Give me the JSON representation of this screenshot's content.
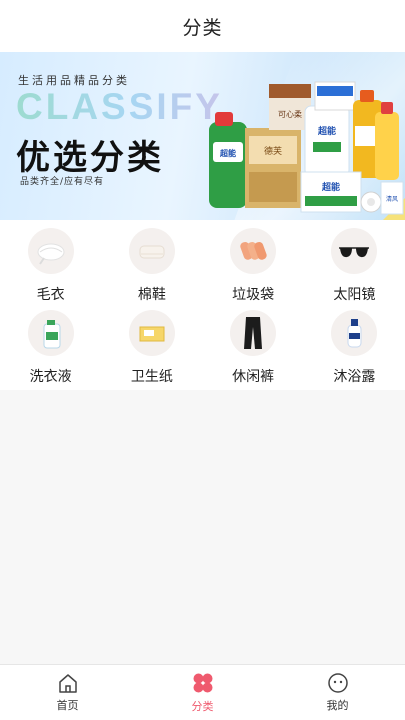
{
  "header": {
    "title": "分类"
  },
  "banner": {
    "tagline": "生活用品精品分类",
    "headline_en": "CLASSIFY",
    "headline_cn": "优选分类",
    "subline": "品类齐全/应有尽有",
    "products": [
      "超能",
      "德芙",
      "可心柔",
      "超能",
      "超能",
      "清风"
    ]
  },
  "categories": [
    {
      "label": "毛衣",
      "icon": "sweater-icon"
    },
    {
      "label": "棉鞋",
      "icon": "cotton-shoes-icon"
    },
    {
      "label": "垃圾袋",
      "icon": "trash-bag-icon"
    },
    {
      "label": "太阳镜",
      "icon": "sunglasses-icon"
    },
    {
      "label": "洗衣液",
      "icon": "detergent-icon"
    },
    {
      "label": "卫生纸",
      "icon": "toilet-paper-icon"
    },
    {
      "label": "休闲裤",
      "icon": "casual-pants-icon"
    },
    {
      "label": "沐浴露",
      "icon": "body-wash-icon"
    }
  ],
  "tabbar": {
    "items": [
      {
        "label": "首页",
        "icon": "home-icon"
      },
      {
        "label": "分类",
        "icon": "category-icon",
        "active": true
      },
      {
        "label": "我的",
        "icon": "profile-icon"
      }
    ],
    "active_color": "#ef5a6e"
  }
}
